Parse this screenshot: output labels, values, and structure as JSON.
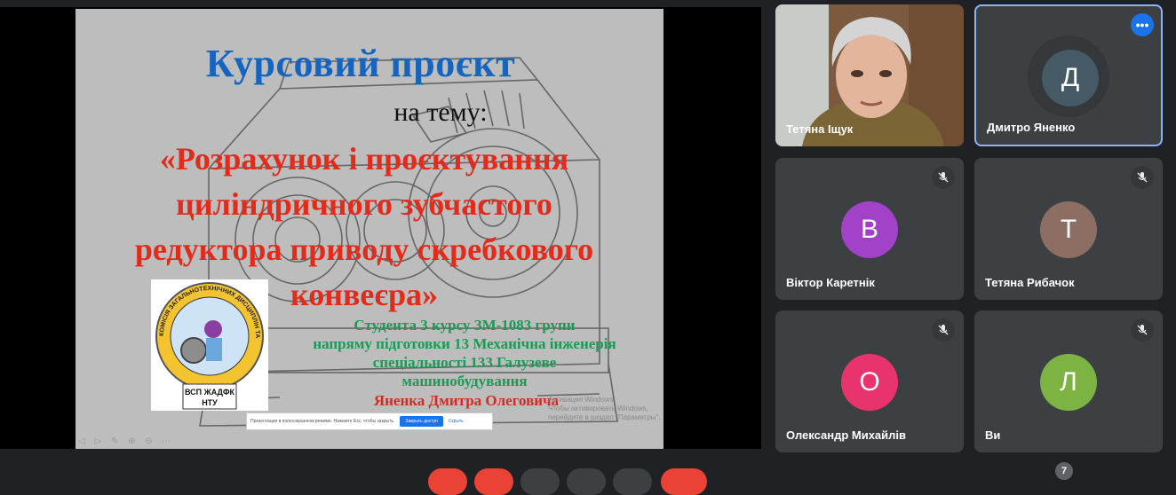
{
  "slide": {
    "title": "Курсовий проєкт",
    "subtitle": "на тему:",
    "topic_lines": [
      "«Розрахунок і проєктування",
      "циліндричного зубчастого",
      "редуктора приводу скребкового",
      "конвеєра»"
    ],
    "student_lines": [
      "Студента 3 курсу ЗМ-1083 групи",
      "напряму підготовки 13 Механічна інженерія",
      "спеціальності 133  Галузеве",
      "машинобудування"
    ],
    "student_name": "Яненка Дмитра Олеговича",
    "logo_ring_text": "КОМІСІЯ ЗАГАЛЬНОТЕХНІЧНИХ ДИСЦИПЛІН ТА МАШИНОБУДІВНИХ ТЕХНОЛОГІЙ",
    "logo_caption_1": "ВСП ЖАДФК",
    "logo_caption_2": "НТУ",
    "notice_text": "Презентация в полноэкранном режиме. Нажмите Esc, чтобы закрыть.",
    "notice_button": "Закрыть доступ",
    "notice_cancel": "Скрыть",
    "activation_line_1": "Активация Windows",
    "activation_line_2": "Чтобы активировать Windows, перейдите в раздел \"Параметры\".",
    "toolbar_icons": "◁ ▷ ✎ ⊕ ⊖ ⋯"
  },
  "participants": [
    {
      "name": "Тетяна Іщук",
      "type": "video"
    },
    {
      "name": "Дмитро Яненко",
      "initial": "Д",
      "color": "#455a64",
      "active": true
    },
    {
      "name": "Віктор Каретнік",
      "initial": "В",
      "color": "#a142c8",
      "muted": true
    },
    {
      "name": "Тетяна Рибачок",
      "initial": "Т",
      "color": "#8d6e63",
      "muted": true
    },
    {
      "name": "Олександр Михайлів",
      "initial": "О",
      "color": "#e8336c",
      "muted": true
    },
    {
      "name": "Ви",
      "initial": "Л",
      "color": "#7cb342",
      "muted": true
    }
  ],
  "controls": {
    "people_count": "7",
    "colors": {
      "danger": "#ea4335",
      "neutral": "#3c4043"
    }
  }
}
